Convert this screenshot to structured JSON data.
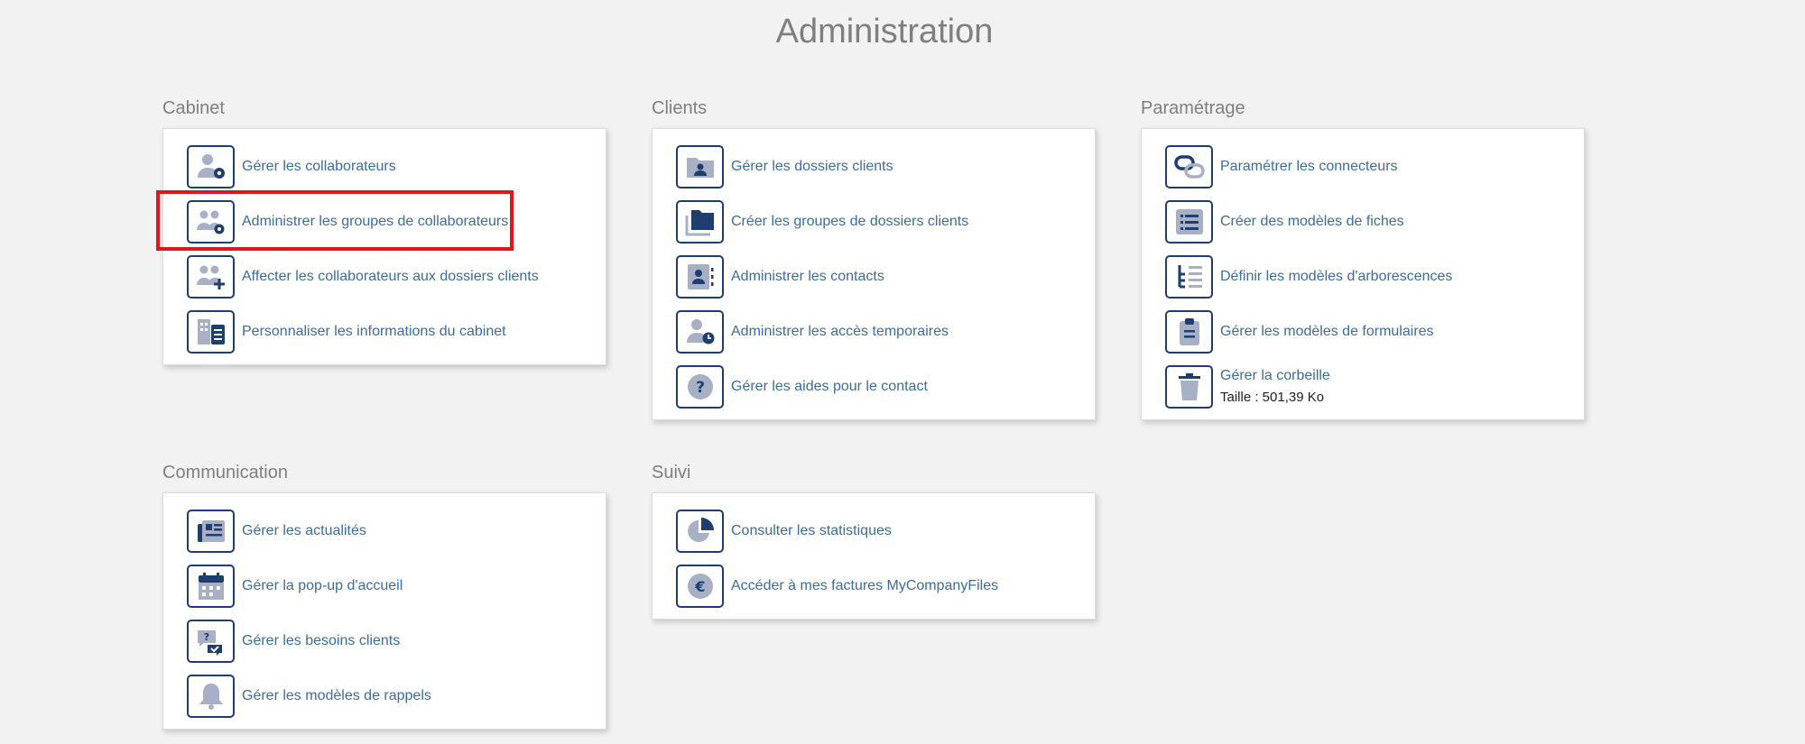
{
  "page": {
    "title": "Administration"
  },
  "sections": {
    "cabinet": {
      "title": "Cabinet",
      "items": [
        {
          "label": "Gérer les collaborateurs"
        },
        {
          "label": "Administrer les groupes de collaborateurs"
        },
        {
          "label": "Affecter les collaborateurs aux dossiers clients"
        },
        {
          "label": "Personnaliser les informations du cabinet"
        }
      ]
    },
    "clients": {
      "title": "Clients",
      "items": [
        {
          "label": "Gérer les dossiers clients"
        },
        {
          "label": "Créer les groupes de dossiers clients"
        },
        {
          "label": "Administrer les contacts"
        },
        {
          "label": "Administrer les accès temporaires"
        },
        {
          "label": "Gérer les aides pour le contact"
        }
      ]
    },
    "parametrage": {
      "title": "Paramétrage",
      "items": [
        {
          "label": "Paramétrer les connecteurs"
        },
        {
          "label": "Créer des modèles de fiches"
        },
        {
          "label": "Définir les modèles d'arborescences"
        },
        {
          "label": "Gérer les modèles de formulaires"
        },
        {
          "label": "Gérer la corbeille",
          "sub": "Taille : 501,39 Ko"
        }
      ]
    },
    "communication": {
      "title": "Communication",
      "items": [
        {
          "label": "Gérer les actualités"
        },
        {
          "label": "Gérer la pop-up d'accueil"
        },
        {
          "label": "Gérer les besoins clients"
        },
        {
          "label": "Gérer les modèles de rappels"
        }
      ]
    },
    "suivi": {
      "title": "Suivi",
      "items": [
        {
          "label": "Consulter les statistiques"
        },
        {
          "label": "Accéder à mes factures MyCompanyFiles"
        }
      ]
    }
  },
  "colors": {
    "accent": "#3b6da0",
    "icon_border": "#1f3d6e",
    "icon_fill": "#a7b0c4",
    "highlight": "#e3141c"
  }
}
